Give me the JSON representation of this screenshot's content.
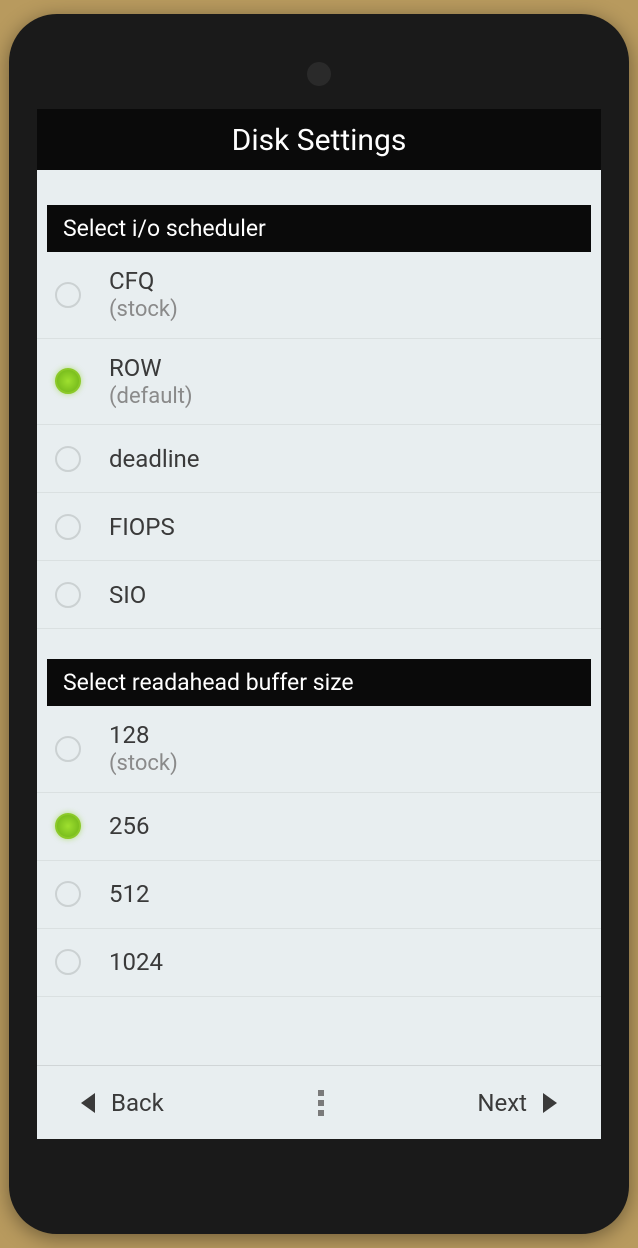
{
  "header": {
    "title": "Disk Settings"
  },
  "sections": {
    "scheduler": {
      "title": "Select i/o scheduler",
      "options": [
        {
          "label": "CFQ",
          "sub": "(stock)",
          "selected": false
        },
        {
          "label": "ROW",
          "sub": "(default)",
          "selected": true
        },
        {
          "label": "deadline",
          "sub": "",
          "selected": false
        },
        {
          "label": "FIOPS",
          "sub": "",
          "selected": false
        },
        {
          "label": "SIO",
          "sub": "",
          "selected": false
        }
      ]
    },
    "readahead": {
      "title": "Select readahead buffer size",
      "options": [
        {
          "label": "128",
          "sub": "(stock)",
          "selected": false
        },
        {
          "label": "256",
          "sub": "",
          "selected": true
        },
        {
          "label": "512",
          "sub": "",
          "selected": false
        },
        {
          "label": "1024",
          "sub": "",
          "selected": false
        }
      ]
    }
  },
  "footer": {
    "back": "Back",
    "next": "Next"
  }
}
